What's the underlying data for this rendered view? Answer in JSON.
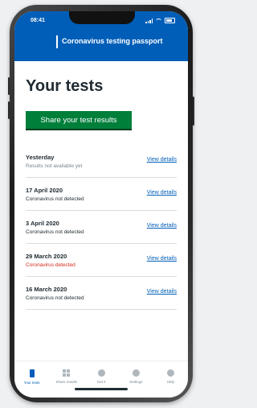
{
  "status_bar": {
    "time": "08:41"
  },
  "header": {
    "title": "Coronavirus testing passport"
  },
  "page": {
    "title": "Your tests"
  },
  "share_button": {
    "label": "Share your test results"
  },
  "tests": [
    {
      "date": "Yesterday",
      "status": "Results not available yet",
      "status_type": "pending",
      "link": "View details"
    },
    {
      "date": "17 April 2020",
      "status": "Coronavirus not detected",
      "status_type": "negative",
      "link": "View details"
    },
    {
      "date": "3 April 2020",
      "status": "Coronavirus not detected",
      "status_type": "negative",
      "link": "View details"
    },
    {
      "date": "29 March 2020",
      "status": "Coronavirus detected",
      "status_type": "positive",
      "link": "View details"
    },
    {
      "date": "16 March 2020",
      "status": "Coronavirus not detected",
      "status_type": "negative",
      "link": "View details"
    }
  ],
  "tab_bar": {
    "tabs": [
      {
        "label": "Your tests",
        "icon": "document-icon",
        "active": true
      },
      {
        "label": "Share results",
        "icon": "grid-icon",
        "active": false
      },
      {
        "label": "Get it",
        "icon": "circle-icon",
        "active": false
      },
      {
        "label": "Settings",
        "icon": "gear-icon",
        "active": false
      },
      {
        "label": "Help",
        "icon": "help-icon",
        "active": false
      }
    ]
  },
  "colors": {
    "header_blue": "#005eb8",
    "button_green": "#007f3b",
    "alert_red": "#d5281b",
    "link_blue": "#005eb8"
  }
}
